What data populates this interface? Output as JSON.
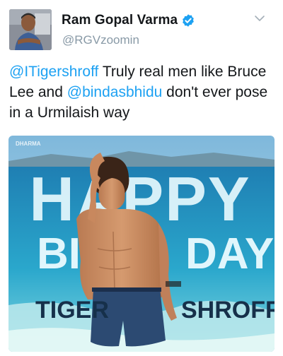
{
  "author": {
    "display_name": "Ram Gopal Varma",
    "handle": "@RGVzoomin",
    "verified": true,
    "avatar_icon": "profile-photo"
  },
  "menu_icon": "chevron-down-icon",
  "tweet": {
    "parts": [
      {
        "type": "mention",
        "text": "@ITigershroff"
      },
      {
        "type": "text",
        "text": " Truly real men like Bruce Lee  and "
      },
      {
        "type": "mention",
        "text": "@bindasbhidu"
      },
      {
        "type": "text",
        "text": " don't ever pose in a Urmilaish way"
      }
    ]
  },
  "media": {
    "watermark": "DHARMA",
    "line1": "HAPPY",
    "line2_left": "BIR",
    "line2_right": "DAY",
    "line3_left": "TIGER",
    "line3_right": "SHROFF"
  },
  "colors": {
    "link": "#1da1f2",
    "verified_badge": "#1da1f2",
    "handle": "#8899a6",
    "sky": "#9fd0ea",
    "sea": "#2a9ec4",
    "headline": "#eafbff",
    "name_text": "#16304a"
  }
}
